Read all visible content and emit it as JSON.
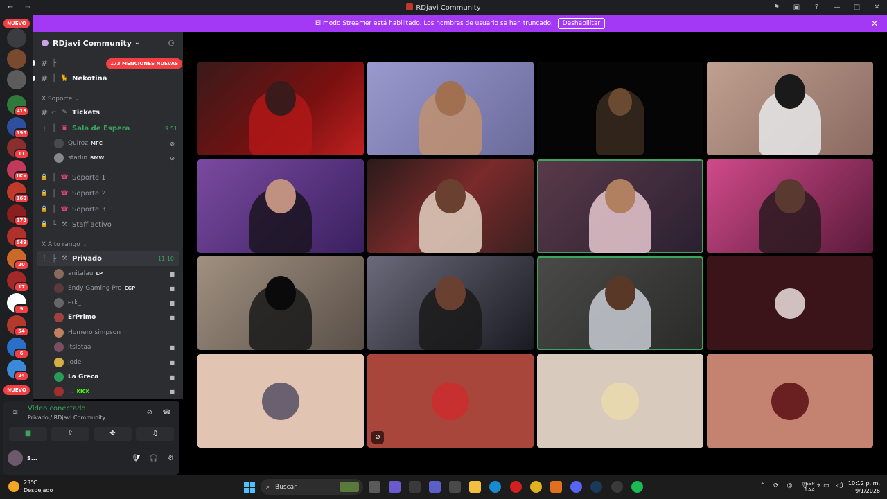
{
  "window": {
    "title": "RDjavi Community"
  },
  "banner": {
    "text": "El modo Streamer está habilitado. Los nombres de usuario se han truncado.",
    "button": "Deshabilitar"
  },
  "server_rail": {
    "nuevo_top": "NUEVO",
    "nuevo_bottom": "NUEVO",
    "badges": [
      "419",
      "195",
      "11",
      "1K+",
      "160",
      "173",
      "549",
      "20",
      "17",
      "9",
      "54",
      "6",
      "24"
    ]
  },
  "guild": {
    "name": "RDjavi Community"
  },
  "mentions_pill": "173 MENCIONES NUEVAS",
  "channels": {
    "nekotina": "Nekotina",
    "soporte_category": "Soporte",
    "tickets": "Tickets",
    "sala_espera": "Sala de Espera",
    "sala_espera_time": "9:51",
    "soporte1": "Soporte 1",
    "soporte2": "Soporte 2",
    "soporte3": "Soporte 3",
    "staff": "Staff activo",
    "alto_category": "Alto rango",
    "privado": "Privado",
    "privado_time": "11:10"
  },
  "sala_users": [
    {
      "name": "Quiroz",
      "tag": "MFC"
    },
    {
      "name": "starlin",
      "tag": "BMW"
    }
  ],
  "privado_users": [
    {
      "name": "anitalau",
      "tag": "LP"
    },
    {
      "name": "Endy Gaming Pro",
      "tag": "EGP"
    },
    {
      "name": "erk_",
      "tag": ""
    },
    {
      "name": "ErPrimo",
      "tag": ""
    },
    {
      "name": "Homero simpson",
      "tag": ""
    },
    {
      "name": "Itslotaa",
      "tag": ""
    },
    {
      "name": "Jodel",
      "tag": ""
    },
    {
      "name": "La Greca",
      "tag": ""
    },
    {
      "name": "...",
      "tag": "KICK"
    }
  ],
  "voice_panel": {
    "status": "Vídeo conectado",
    "location": "Privado / RDjavi Community",
    "user_name": "S..."
  },
  "taskbar": {
    "temp": "23°C",
    "weather": "Despejado",
    "search_placeholder": "Buscar",
    "lang1": "ESP",
    "lang2": "LAA",
    "time": "10:12 p. m.",
    "date": "9/1/2026"
  },
  "colors": {
    "banner": "#a338f5",
    "connected": "#3ba55d",
    "badge": "#f23f43",
    "sidebar": "#2b2d31",
    "rail": "#1e1f22"
  }
}
